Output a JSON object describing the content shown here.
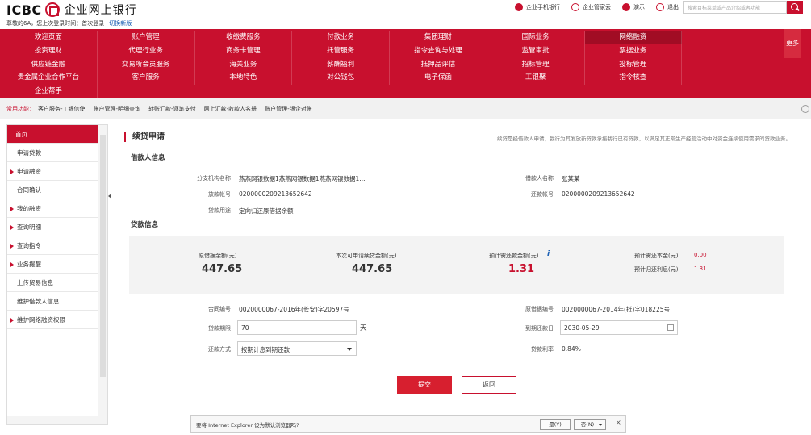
{
  "header": {
    "logo_text": "ICBC",
    "logo_cn": "企业网上银行",
    "welcome": "尊敬的6A，您上次登录时间：首次登录",
    "switch_link": "切换新版",
    "links": [
      {
        "label": "企业手机银行",
        "icon": "mobile-bank-icon"
      },
      {
        "label": "企业管家云",
        "icon": "cloud-icon"
      },
      {
        "label": "演示",
        "icon": "demo-icon"
      },
      {
        "label": "退出",
        "icon": "logout-icon"
      }
    ],
    "search_placeholder": "搜索目标菜单或产品介绍或者功能"
  },
  "nav": {
    "items": [
      "欢迎页面",
      "账户管理",
      "收缴费服务",
      "付款业务",
      "集团理财",
      "国际业务",
      "网络融资",
      "",
      "投资理财",
      "代理行业务",
      "商务卡管理",
      "托管服务",
      "指令查询与处理",
      "监管审批",
      "票据业务",
      "",
      "供应链金融",
      "交易所会员服务",
      "海关业务",
      "薪酬福利",
      "抵押品评估",
      "招标管理",
      "投标管理",
      "",
      "贵金属企业合作平台",
      "客户服务",
      "本地特色",
      "对公钱包",
      "电子保函",
      "工银聚",
      "指令核查",
      "",
      "企业帮手"
    ],
    "active_index": 6,
    "more_label": "更多"
  },
  "common": {
    "label": "常用功能：",
    "items": [
      "客户服务-工银信使",
      "账户管理-明细查询",
      "转账汇款-逐笔支付",
      "网上汇款-收款人名册",
      "账户管理-银企对账"
    ]
  },
  "sidebar": {
    "items": [
      {
        "label": "首页",
        "active": true,
        "arrow": false
      },
      {
        "label": "申请贷款",
        "active": false,
        "arrow": false
      },
      {
        "label": "申请融资",
        "active": false,
        "arrow": true
      },
      {
        "label": "合同确认",
        "active": false,
        "arrow": false
      },
      {
        "label": "我的融资",
        "active": false,
        "arrow": true
      },
      {
        "label": "查询明细",
        "active": false,
        "arrow": true
      },
      {
        "label": "查询指令",
        "active": false,
        "arrow": true
      },
      {
        "label": "业务提醒",
        "active": false,
        "arrow": true
      },
      {
        "label": "上传贸易信息",
        "active": false,
        "arrow": false
      },
      {
        "label": "维护借款人信息",
        "active": false,
        "arrow": false
      },
      {
        "label": "维护网络融资权限",
        "active": false,
        "arrow": true
      }
    ]
  },
  "main": {
    "title": "续贷申请",
    "desc": "续贷是经借款人申请，我行为其发放新贷款承接我行已有贷款，以满足其正常生产经营活动中对资金连续使用需求的贷款业务。",
    "borrower_section": "借款人信息",
    "loan_section": "贷款信息",
    "borrower": {
      "branch_label": "分支机构名称",
      "branch_value": "燕燕网银数据1燕燕网银数据1燕燕网银数据1...",
      "borrower_label": "借款人名称",
      "borrower_value": "张某某",
      "disburse_label": "放款帐号",
      "disburse_value": "0200000209213652642",
      "repay_label": "还款帐号",
      "repay_value": "0200000209213652642",
      "purpose_label": "贷款用途",
      "purpose_value": "定向归还原借据余额"
    },
    "summary": {
      "orig_label": "原借据余额(元)",
      "orig_value": "447.65",
      "apply_label": "本次可申请续贷金额(元)",
      "apply_value": "447.65",
      "est_label": "预计需还款金额(元)",
      "est_value": "1.31",
      "principal_label": "预计需还本金(元)",
      "principal_value": "0.00",
      "interest_label": "预计归还利息(元)",
      "interest_value": "1.31"
    },
    "form": {
      "contract_label": "合同编号",
      "contract_value": "0020000067-2016年(长安)字20597号",
      "receipt_label": "原借据编号",
      "receipt_value": "0020000067-2014年(抵)字018225号",
      "term_label": "贷款期限",
      "term_value": "70",
      "term_unit": "天",
      "due_label": "到期还款日",
      "due_value": "2030-05-29",
      "method_label": "还款方式",
      "method_value": "按期计息到期还款",
      "rate_label": "贷款利率",
      "rate_value": "0.84%"
    },
    "submit_label": "提交",
    "back_label": "返回"
  },
  "ie_bar": {
    "text": "要将 Internet Explorer 设为默认浏览器吗?",
    "yes_label": "是(Y)",
    "no_label": "否(N)",
    "close_label": "×"
  },
  "colors": {
    "brand_red": "#c8102e"
  }
}
